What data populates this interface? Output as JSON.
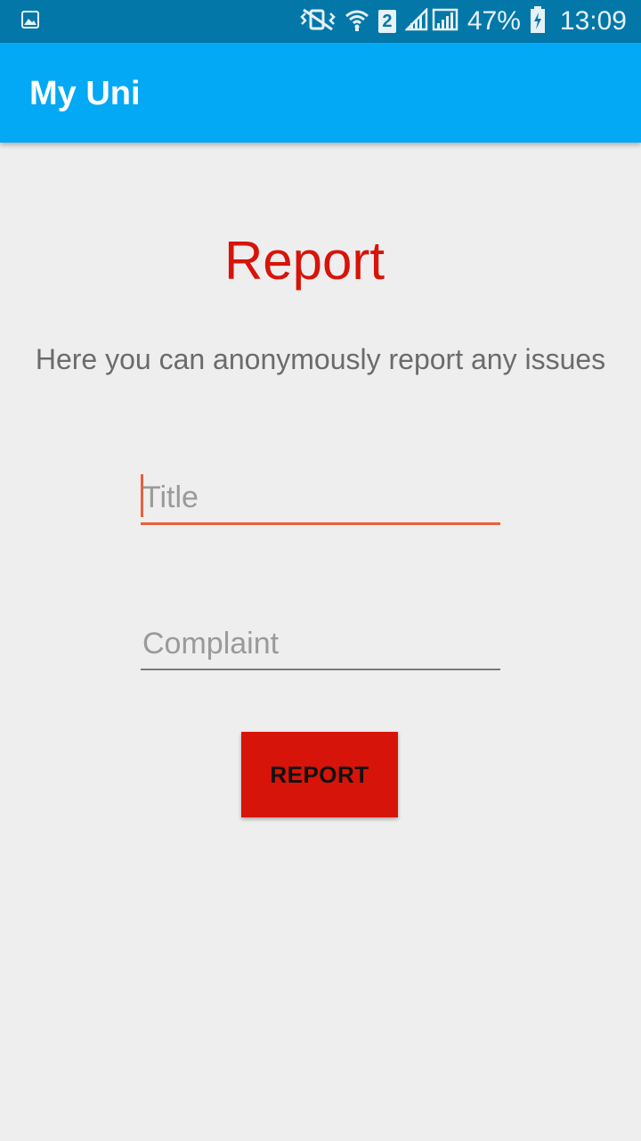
{
  "status_bar": {
    "icons": [
      "gallery-icon",
      "vibrate-icon",
      "wifi-icon",
      "sim-icon",
      "signal-icon",
      "battery-icon"
    ],
    "sim_number": "2",
    "battery_percent": "47%",
    "time": "13:09"
  },
  "app_bar": {
    "title": "My Uni"
  },
  "page": {
    "heading": "Report",
    "description": "Here you can anonymously report any issues"
  },
  "form": {
    "title_placeholder": "Title",
    "title_value": "",
    "complaint_placeholder": "Complaint",
    "complaint_value": "",
    "submit_label": "REPORT"
  },
  "colors": {
    "status_bar": "#0277a8",
    "app_bar": "#03a9f4",
    "accent_red": "#d71409",
    "focus_orange": "#e8603c",
    "background": "#eeeeee"
  }
}
